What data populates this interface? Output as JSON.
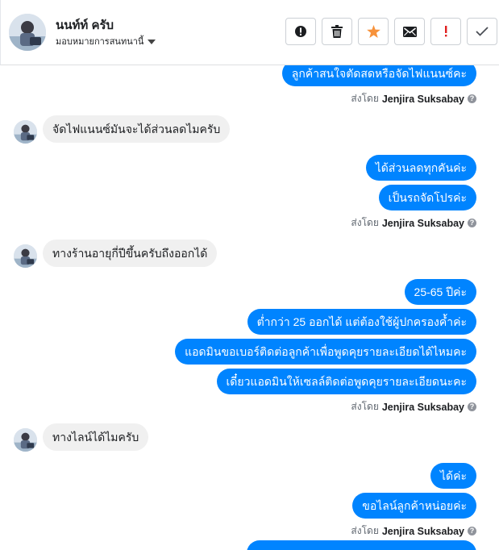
{
  "header": {
    "contact_name": "นนท์ท์ ครับ",
    "assign_label": "มอบหมายการสนทนานี้",
    "actions": [
      "mark-spam",
      "delete",
      "star",
      "mark-unread",
      "flag-important",
      "done"
    ]
  },
  "colors": {
    "outgoing_bubble": "#0084ff",
    "incoming_bubble": "#f0f0f0",
    "star": "#f7923b",
    "important": "#e02020"
  },
  "thread": {
    "sent_by_label": "ส่งโดย",
    "agent_name": "Jenjira Suksabay",
    "help_glyph": "?",
    "messages": [
      {
        "from": "page",
        "text": "ลูกค้าสนใจตัดสดหรือจัดไฟแนนซ์คะ"
      },
      {
        "from": "customer",
        "text": "จัดไฟแนนซ์มันจะได้ส่วนลดไมครับ"
      },
      {
        "from": "page",
        "text": "ได้ส่วนลดทุกคันค่ะ"
      },
      {
        "from": "page",
        "text": "เป็นรถจัดโปรค่ะ"
      },
      {
        "from": "customer",
        "text": "ทางร้านอายุกี่ปีขึ้นครับถึงออกได้"
      },
      {
        "from": "page",
        "text": "25-65 ปีค่ะ"
      },
      {
        "from": "page",
        "text": "ต่ำกว่า 25 ออกได้ แต่ต้องใช้ผู้ปกครองค้ำค่ะ"
      },
      {
        "from": "page",
        "text": "แอดมินขอเบอร์ติดต่อลูกค้าเพื่อพูดคุยรายละเอียดได้ไหมคะ"
      },
      {
        "from": "page",
        "text": "เดี๋ยวแอดมินให้เซลล์ติดต่อพูดคุยรายละเอียดนะคะ"
      },
      {
        "from": "customer",
        "text": "ทางไลน์ได้ไมครับ"
      },
      {
        "from": "page",
        "text": "ได้ค่ะ"
      },
      {
        "from": "page",
        "text": "ขอไลน์ลูกค้าหน่อยค่ะ"
      }
    ]
  }
}
